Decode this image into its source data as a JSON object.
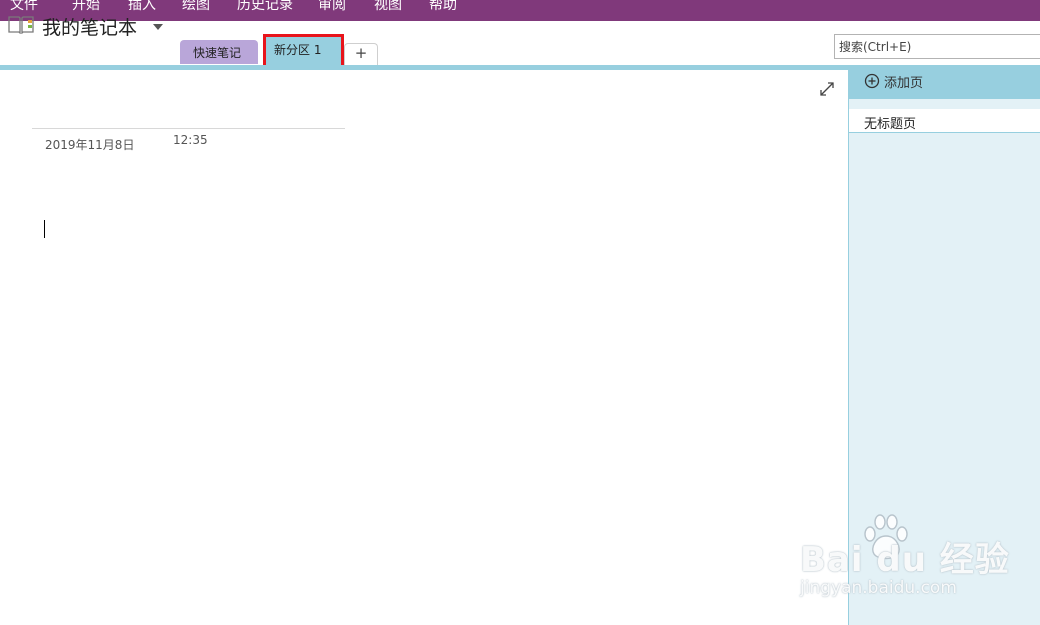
{
  "ribbon": {
    "tabs": [
      "文件",
      "开始",
      "插入",
      "绘图",
      "历史记录",
      "审阅",
      "视图",
      "帮助"
    ],
    "color": "#80397b"
  },
  "notebook": {
    "name": "我的笔记本",
    "icon": "notebook-icon",
    "sections": [
      {
        "label": "快速笔记",
        "color": "#b9a6d9"
      },
      {
        "label": "新分区 1",
        "color": "#97cfdf",
        "active": true
      }
    ],
    "add_section_label": "+"
  },
  "search": {
    "placeholder": "搜索(Ctrl+E)"
  },
  "page": {
    "date": "2019年11月8日",
    "time": "12:35"
  },
  "page_pane": {
    "add_page_label": "添加页",
    "pages": [
      "无标题页"
    ]
  },
  "watermark": {
    "brand": "Bai du 经验",
    "url": "jingyan.baidu.com"
  },
  "colors": {
    "ribbon": "#80397b",
    "section_accent": "#97cfdf",
    "pane_bg": "#e3f1f6",
    "highlight": "#e8141b"
  }
}
